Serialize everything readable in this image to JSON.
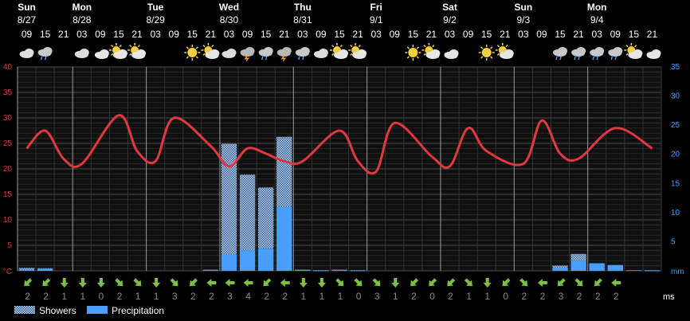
{
  "chart_data": {
    "type": "line",
    "days": [
      {
        "name": "Sun",
        "date": "8/27"
      },
      {
        "name": "Mon",
        "date": "8/28"
      },
      {
        "name": "Tue",
        "date": "8/29"
      },
      {
        "name": "Wed",
        "date": "8/30"
      },
      {
        "name": "Thu",
        "date": "8/31"
      },
      {
        "name": "Fri",
        "date": "9/1"
      },
      {
        "name": "Sat",
        "date": "9/2"
      },
      {
        "name": "Sun",
        "date": "9/3"
      },
      {
        "name": "Mon",
        "date": "9/4"
      }
    ],
    "hours": [
      "09",
      "15",
      "21",
      "03",
      "09",
      "15",
      "21",
      "03",
      "09",
      "15",
      "21",
      "03",
      "09",
      "15",
      "21",
      "03",
      "09",
      "15",
      "21",
      "03",
      "09",
      "15",
      "21",
      "03",
      "09",
      "15",
      "21",
      "03",
      "09",
      "15",
      "21",
      "03",
      "09",
      "15",
      "21"
    ],
    "day_start_slots": [
      0,
      3,
      7,
      11,
      15,
      19,
      23,
      27,
      31
    ],
    "weather_icons": [
      "cloudy",
      "rain",
      "moon",
      "cloudy",
      "partly-cloudy-night",
      "partly-sunny",
      "partly-sunny",
      "moon",
      "moon",
      "sunny",
      "partly-sunny",
      "cloudy",
      "thunderstorm",
      "rain",
      "thunderstorm",
      "rain",
      "cloudy",
      "partly-sunny",
      "partly-sunny",
      "moon",
      "moon",
      "sunny",
      "partly-sunny",
      "partly-cloudy-night",
      "moon",
      "sunny",
      "partly-sunny",
      "moon",
      "moon",
      "rain",
      "rain",
      "rain",
      "rain",
      "partly-sunny",
      "partly-cloudy-night"
    ],
    "temperature": {
      "name": "Temperature",
      "unit": "°C",
      "color": "#e0383f",
      "ylim": [
        0,
        40
      ],
      "yticks": [
        0,
        5,
        10,
        15,
        20,
        25,
        30,
        35,
        40
      ],
      "values": [
        24,
        27.5,
        22,
        21,
        30.5,
        23.5,
        21.5,
        30,
        24.5,
        20.5,
        24,
        23,
        21.5,
        21.5,
        27.5,
        21.5,
        19.5,
        29,
        22.5,
        20.5,
        28,
        23.5,
        21,
        29.5,
        23,
        22,
        28,
        24
      ]
    },
    "temperature_hours": [
      0,
      1,
      2,
      3,
      5,
      6,
      7,
      8,
      10,
      11,
      12,
      13,
      14,
      15,
      17,
      18,
      19,
      20,
      22,
      23,
      24,
      25,
      27,
      28,
      29,
      30,
      32,
      34
    ],
    "precip_axis": {
      "unit": "mm",
      "color": "#4a9eff",
      "ylim": [
        0,
        35
      ],
      "yticks": [
        5,
        10,
        15,
        20,
        25,
        30,
        35
      ]
    },
    "showers": {
      "name": "Showers",
      "values": [
        0.3,
        0.15,
        0,
        0,
        0,
        0,
        0,
        0,
        0,
        0,
        0.1,
        19,
        13,
        10.5,
        12,
        0.1,
        0.05,
        0.1,
        0.05,
        0,
        0,
        0,
        0,
        0,
        0,
        0,
        0,
        0,
        0,
        0.4,
        1.2,
        0,
        0,
        0,
        0.05
      ]
    },
    "precipitation": {
      "name": "Precipitation",
      "color": "#4a9eff",
      "values": [
        0.2,
        0.3,
        0,
        0,
        0,
        0,
        0,
        0,
        0,
        0,
        0.1,
        2.8,
        3.5,
        3.8,
        11,
        0.1,
        0.05,
        0.1,
        0.05,
        0,
        0,
        0,
        0,
        0,
        0,
        0,
        0,
        0,
        0,
        0.5,
        1.7,
        1.3,
        1.0,
        0.1,
        0.05
      ]
    },
    "wind": {
      "unit": "ms",
      "speeds": [
        "2",
        "2",
        "1",
        "1",
        "0",
        "2",
        "1",
        "1",
        "3",
        "2",
        "2",
        "3",
        "4",
        "2",
        "2",
        "1",
        "1",
        "1",
        "0",
        "3",
        "1",
        "2",
        "0",
        "2",
        "1",
        "1",
        "0",
        "2",
        "2",
        "3",
        "2",
        "2",
        "2"
      ],
      "directions": [
        45,
        45,
        0,
        0,
        0,
        315,
        315,
        0,
        315,
        45,
        90,
        90,
        90,
        45,
        90,
        0,
        0,
        315,
        315,
        315,
        0,
        45,
        45,
        45,
        315,
        0,
        45,
        315,
        90,
        45,
        315,
        45,
        90
      ]
    },
    "legend": [
      {
        "name": "Showers",
        "style": "hatched"
      },
      {
        "name": "Precipitation",
        "style": "solid"
      }
    ],
    "grid": true
  }
}
